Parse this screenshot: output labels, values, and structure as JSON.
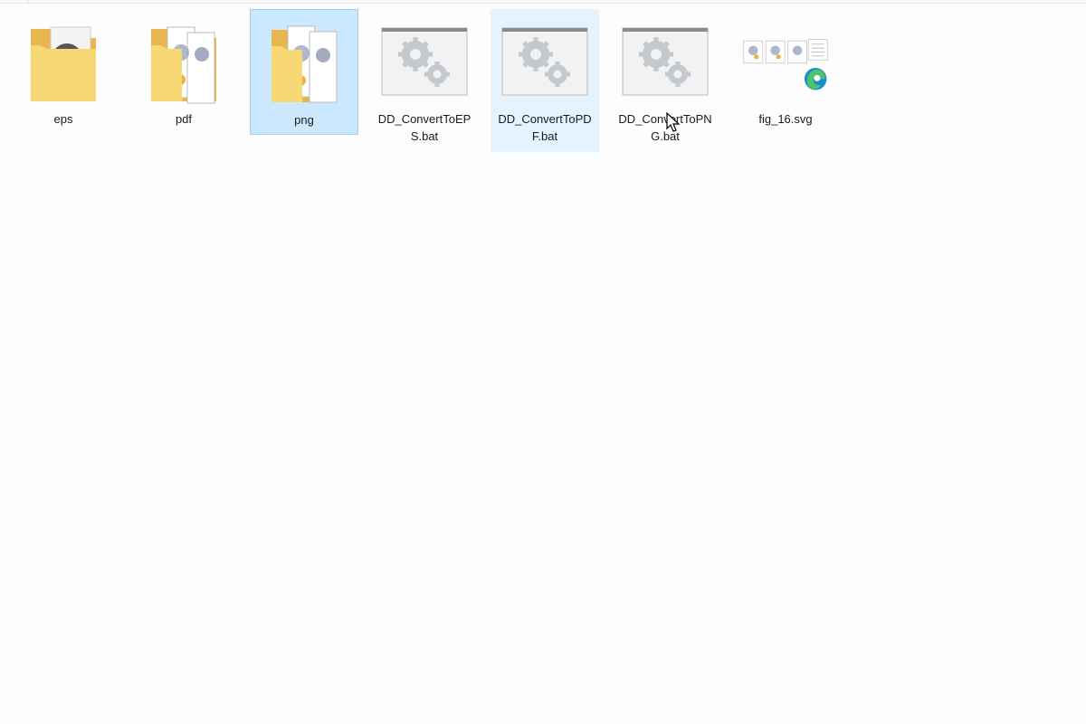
{
  "items": [
    {
      "name": "eps",
      "type": "folder-gimp",
      "state": "normal"
    },
    {
      "name": "pdf",
      "type": "folder-documents",
      "state": "normal"
    },
    {
      "name": "png",
      "type": "folder-documents",
      "state": "selected"
    },
    {
      "name": "DD_ConvertToEPS.bat",
      "type": "batch-file",
      "state": "normal"
    },
    {
      "name": "DD_ConvertToPDF.bat",
      "type": "batch-file",
      "state": "hovered"
    },
    {
      "name": "DD_ConvertToPNG.bat",
      "type": "batch-file",
      "state": "normal"
    },
    {
      "name": "fig_16.svg",
      "type": "svg-edge",
      "state": "normal"
    }
  ],
  "colors": {
    "selection_fill": "#cce8ff",
    "selection_border": "#99d1ff",
    "hover_fill": "#e5f3ff",
    "folder": "#f8d775",
    "edge_blue": "#1b8ad6",
    "edge_green": "#4fc36a"
  },
  "icons": {
    "folder": "folder-icon",
    "batch": "gears-icon",
    "svg": "edge-icon",
    "cursor": "mouse-cursor-icon"
  }
}
